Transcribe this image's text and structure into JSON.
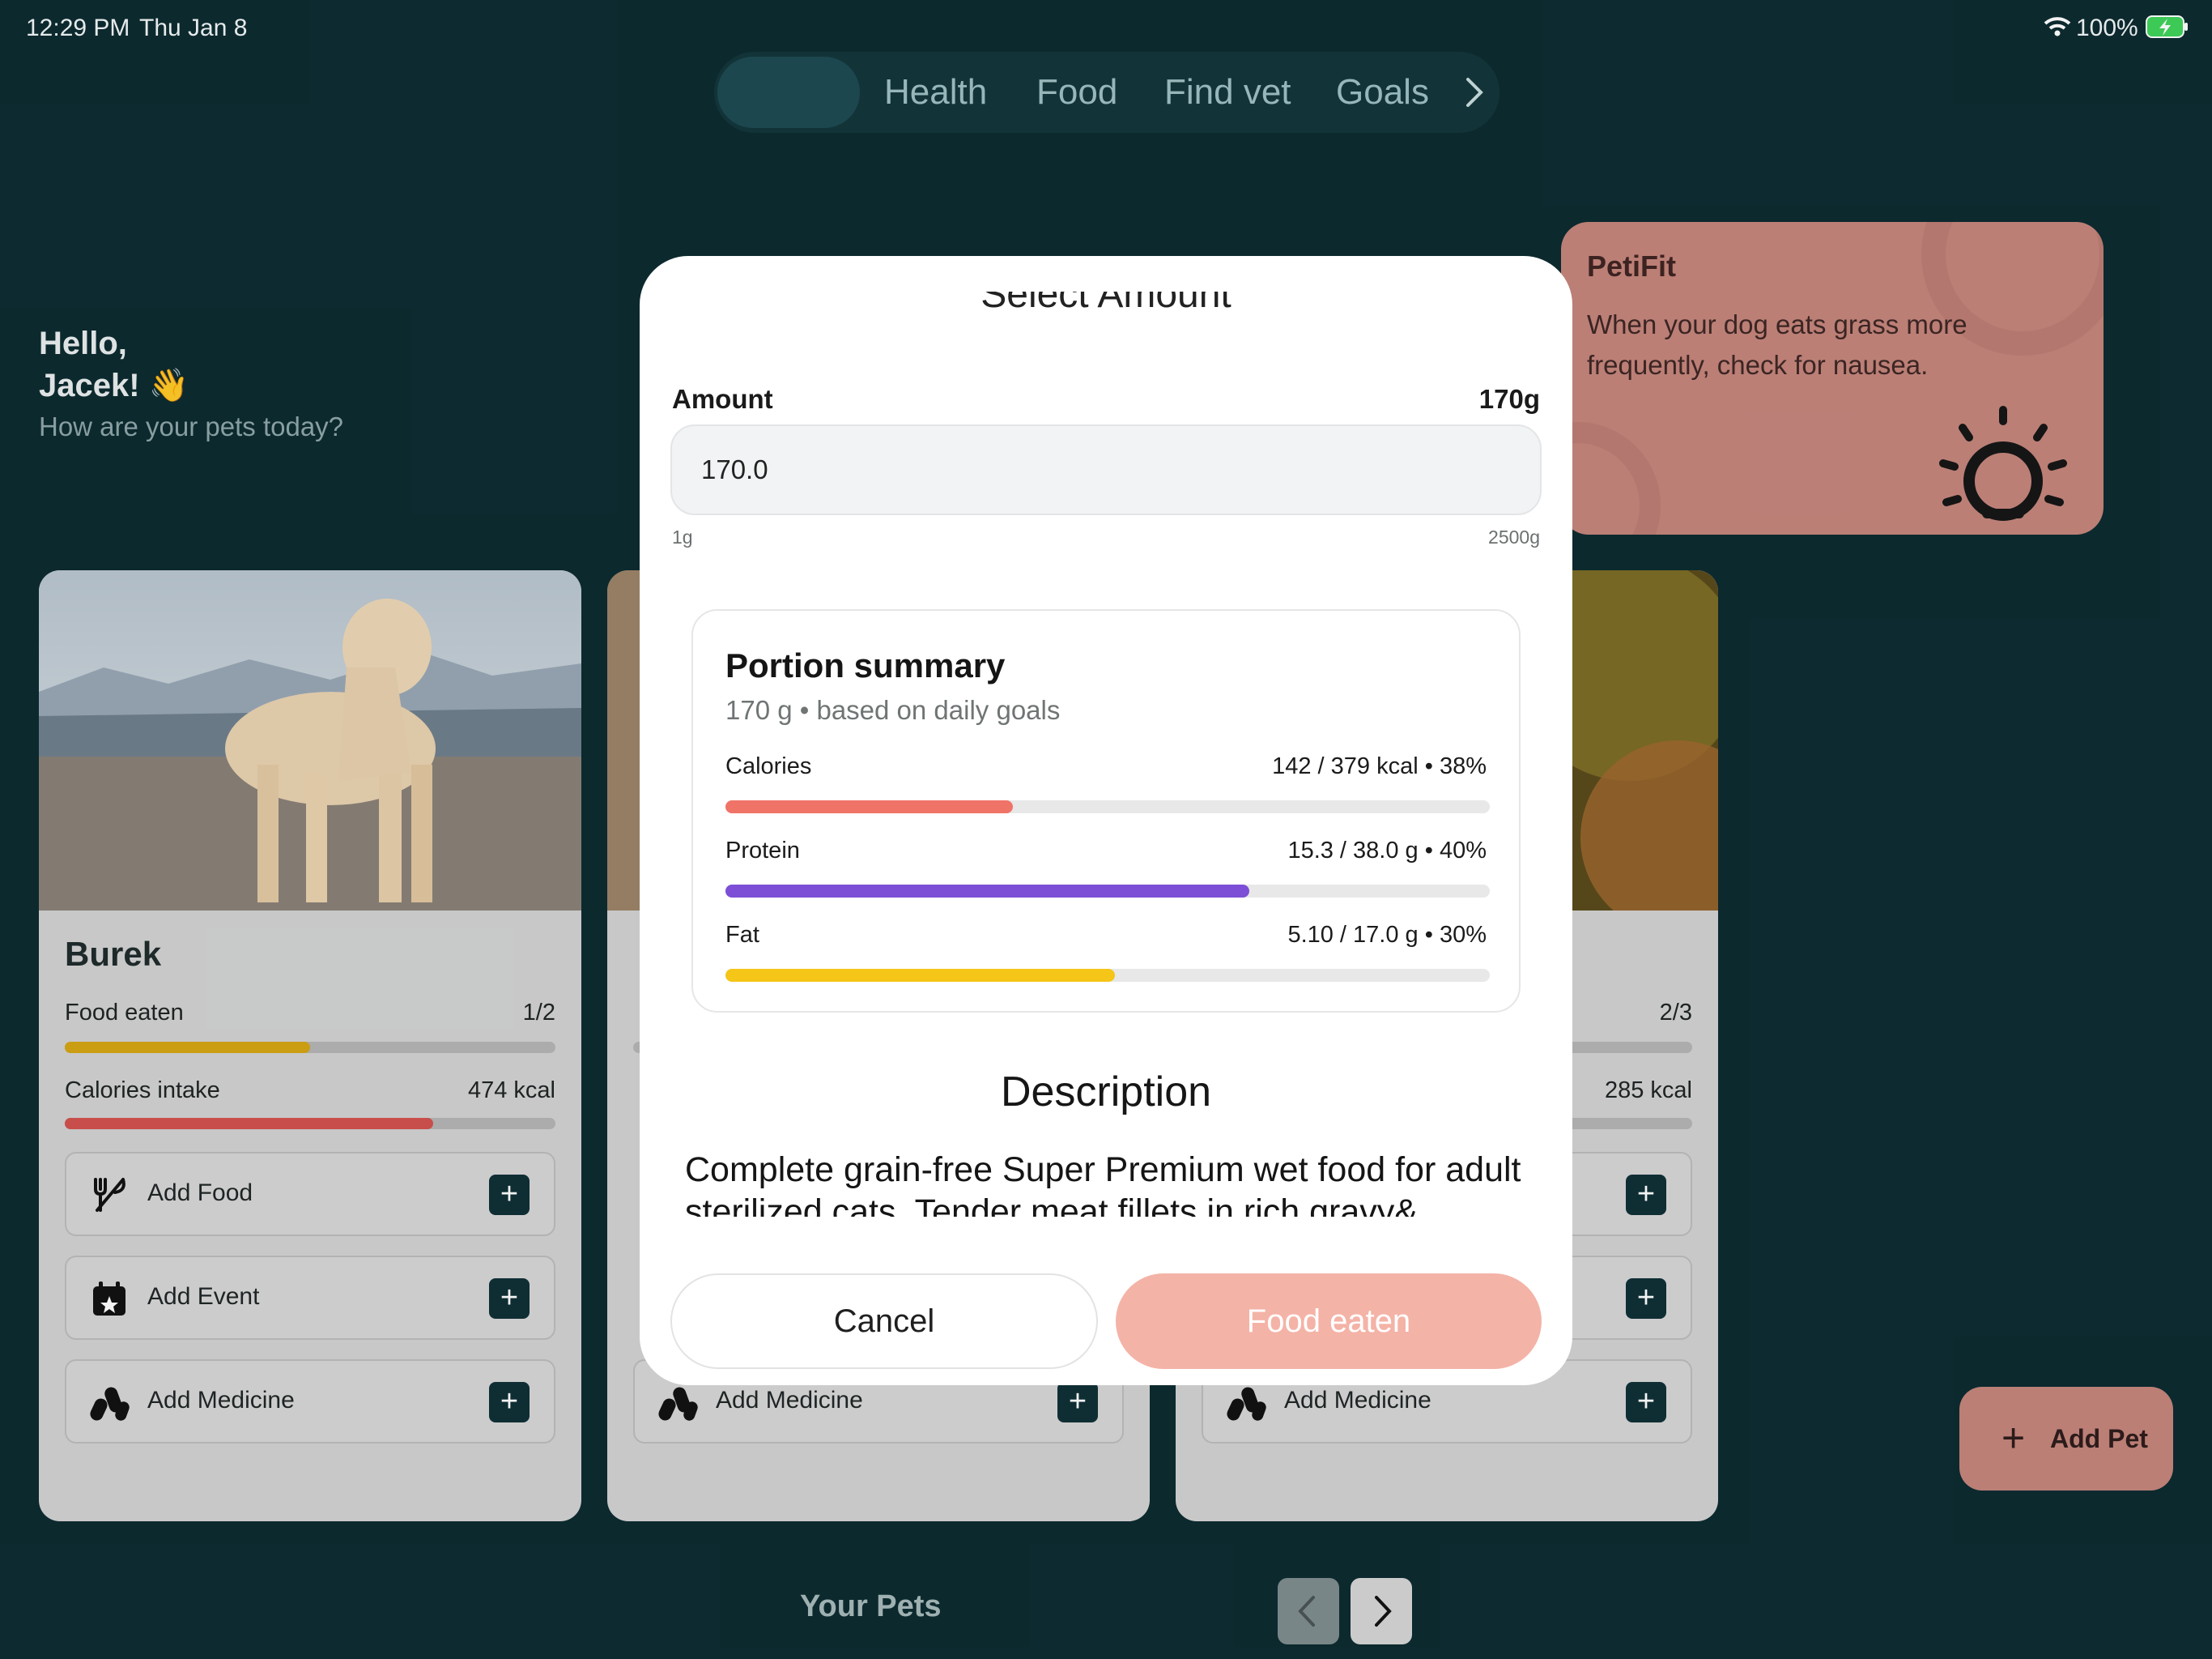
{
  "status_bar": {
    "time": "12:29 PM",
    "date": "Thu Jan 8",
    "battery": "100%"
  },
  "nav": {
    "tabs": [
      "Health",
      "Food",
      "Find vet",
      "Goals"
    ]
  },
  "greeting": {
    "line1": "Hello,",
    "line2": "Jacek! 👋",
    "subtitle": "How are your pets today?"
  },
  "tip_card": {
    "brand": "PetiFit",
    "text": "When your dog eats grass more frequently, check for nausea."
  },
  "pets": [
    {
      "name": "Burek",
      "food_label": "Food eaten",
      "food_value": "1/2",
      "food_progress": 0.5,
      "calories_label": "Calories intake",
      "calories_value": "474 kcal",
      "calories_progress": 0.75
    },
    {
      "name": "",
      "food_label": "",
      "food_value": "",
      "food_progress": 0.0,
      "calories_label": "",
      "calories_value": "",
      "calories_progress": 0.0
    },
    {
      "name": "",
      "food_label": "",
      "food_value": "2/3",
      "food_progress": 0.67,
      "calories_label": "",
      "calories_value": "285 kcal",
      "calories_progress": 0.45
    }
  ],
  "actions": {
    "add_food": "Add Food",
    "add_event": "Add Event",
    "add_medicine": "Add Medicine",
    "plus": "+"
  },
  "bottom": {
    "your_pets": "Your Pets",
    "add_pet": "Add Pet",
    "add_pet_plus": "+"
  },
  "modal": {
    "peek_title": "Select Amount",
    "amount_label": "Amount",
    "amount_value": "170g",
    "amount_input": "170.0",
    "min_label": "1g",
    "max_label": "2500g",
    "summary": {
      "title": "Portion summary",
      "subtitle": "170 g • based on daily goals",
      "metrics": [
        {
          "label": "Calories",
          "value": "142 / 379 kcal • 38%",
          "progress": 0.376,
          "color": "#f07368"
        },
        {
          "label": "Protein",
          "value": "15.3 / 38.0 g • 40%",
          "progress": 0.685,
          "color": "#7c4fd6"
        },
        {
          "label": "Fat",
          "value": "5.10 / 17.0 g • 30%",
          "progress": 0.51,
          "color": "#f5c518"
        }
      ]
    },
    "description_title": "Description",
    "description_text": "Complete grain-free Super Premium wet food for adult sterilized cats. Tender meat fillets in rich gravy& enriched",
    "cancel_label": "Cancel",
    "confirm_label": "Food eaten"
  },
  "colors": {
    "background": "#0c2b30",
    "accent": "#f4b3a7",
    "tip": "#c5857c",
    "food_bar": "#d4a514",
    "calories_bar": "#d2524f"
  }
}
